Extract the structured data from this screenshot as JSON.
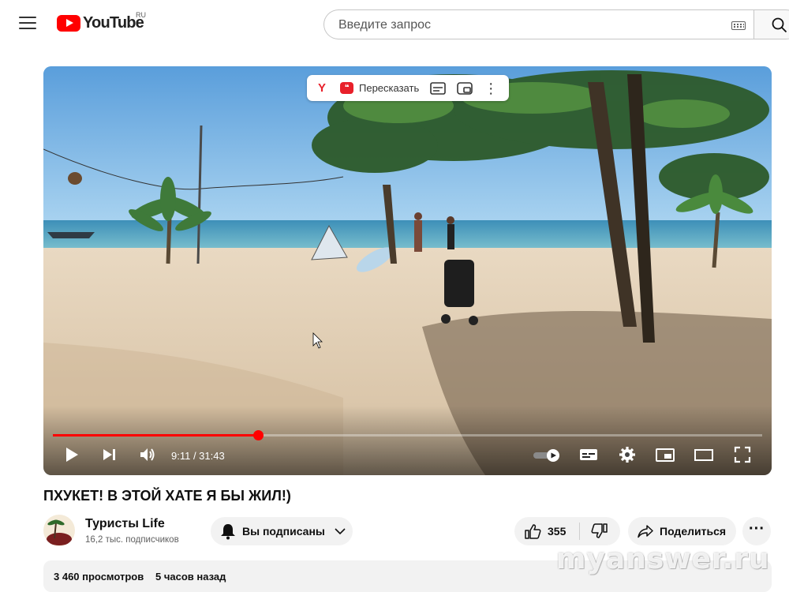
{
  "header": {
    "logo_text": "YouTube",
    "region": "RU",
    "search_placeholder": "Введите запрос"
  },
  "player": {
    "overlay": {
      "yandex_letter": "Y",
      "retell_label": "Пересказать"
    },
    "time_current": "9:11",
    "time_total": "31:43",
    "time_display": "9:11 / 31:43",
    "progress_fraction": 0.2895
  },
  "video": {
    "title": "ПХУКЕТ! В ЭТОЙ ХАТЕ Я БЫ ЖИЛ!)"
  },
  "channel": {
    "name": "Туристы Life",
    "subscribers": "16,2 тыс. подписчиков",
    "subscribe_label": "Вы подписаны"
  },
  "actions": {
    "like_count": "355",
    "share_label": "Поделиться",
    "more_label": "···"
  },
  "description": {
    "views": "3 460 просмотров",
    "age": "5 часов назад"
  },
  "watermark": "myanswer.ru",
  "colors": {
    "brand": "#ff0000",
    "chip_bg": "#f2f2f2"
  }
}
